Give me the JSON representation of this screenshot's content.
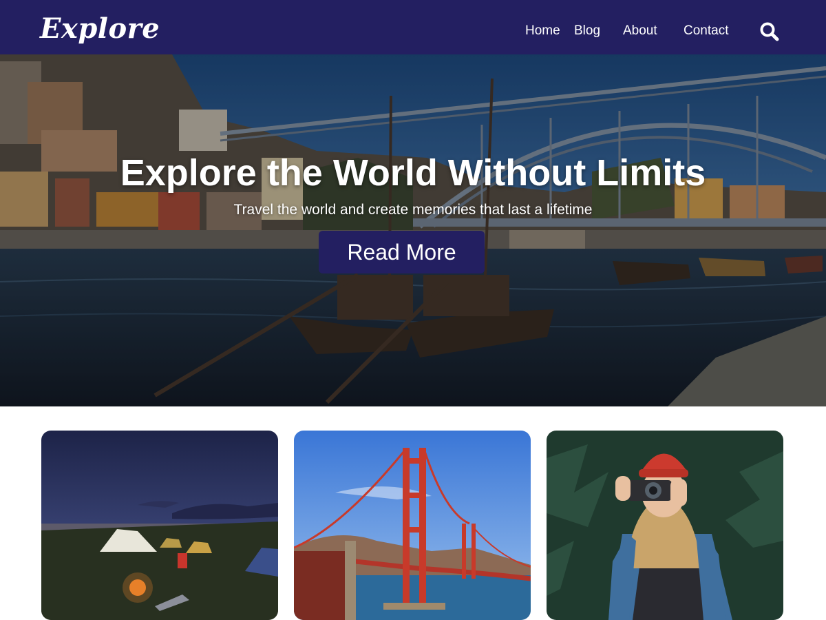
{
  "header": {
    "logo": "Explore",
    "nav": [
      "Home",
      "Blog",
      "About",
      "Contact"
    ],
    "search_icon": "search-icon"
  },
  "hero": {
    "title": "Explore the World Without Limits",
    "subtitle": "Travel the world and create memories that last a lifetime",
    "button_label": "Read More"
  },
  "colors": {
    "brand": "#231f61",
    "text_on_brand": "#ffffff"
  },
  "cards": [
    {
      "image": "night-camping-photo"
    },
    {
      "image": "golden-gate-bridge-photo"
    },
    {
      "image": "photographer-with-camera-photo"
    }
  ]
}
